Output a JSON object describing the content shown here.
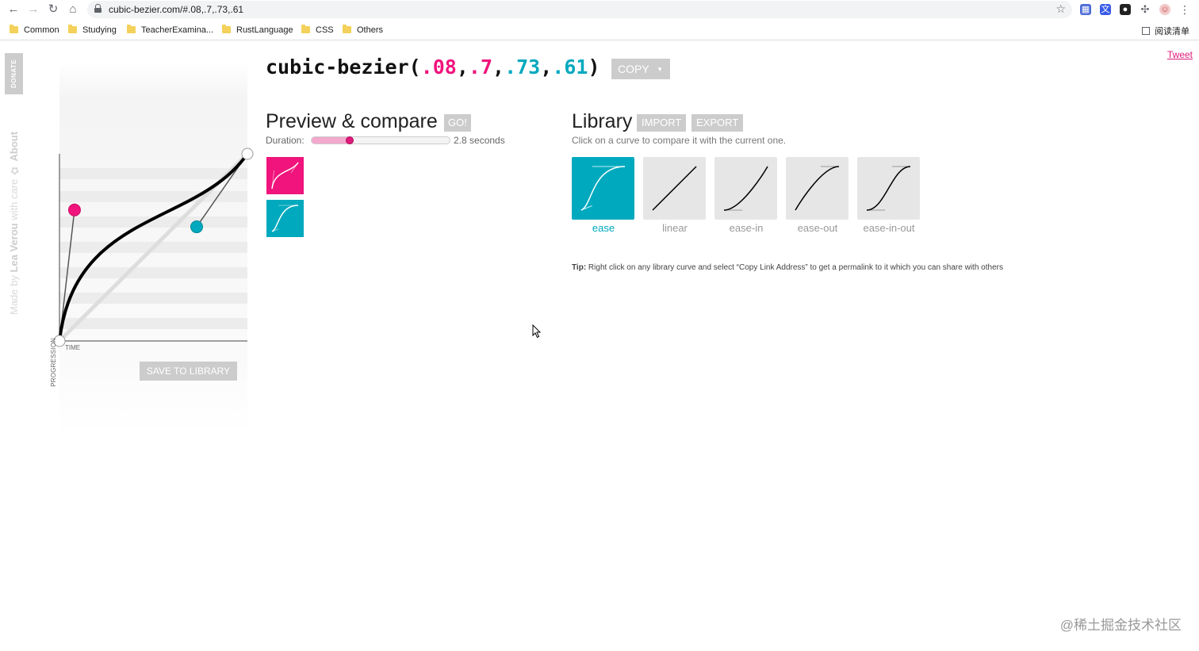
{
  "browser": {
    "url": "cubic-bezier.com/#.08,.7,.73,.61",
    "bookmarks": [
      "Common",
      "Studying",
      "TeacherExamina...",
      "RustLanguage",
      "CSS",
      "Others"
    ],
    "reading_list": "阅读清单"
  },
  "sidebar": {
    "donate": "DONATE",
    "credit_prefix": "Made by ",
    "credit_author": "Lea Verou",
    "credit_suffix": " with care",
    "about": "About"
  },
  "editor": {
    "func_open": "cubic-bezier(",
    "p1x": ".08",
    "p1y": ".7",
    "p2x": ".73",
    "p2y": ".61",
    "func_close": ")",
    "sep": ",",
    "copy_label": "COPY",
    "y_axis_label": "PROGRESSION",
    "x_axis_label": "TIME",
    "save_label": "SAVE TO LIBRARY",
    "control_points": {
      "p1": [
        0.08,
        0.7
      ],
      "p2": [
        0.73,
        0.61
      ]
    }
  },
  "preview": {
    "title": "Preview & compare",
    "go_label": "GO!",
    "duration_label": "Duration:",
    "duration_value": "2.8 seconds",
    "duration_fraction": 0.28
  },
  "library": {
    "title": "Library",
    "import_label": "IMPORT",
    "export_label": "EXPORT",
    "subtitle": "Click on a curve to compare it with the current one.",
    "items": [
      {
        "name": "ease",
        "p": [
          0.25,
          0.1,
          0.25,
          1
        ],
        "active": true
      },
      {
        "name": "linear",
        "p": [
          0,
          0,
          1,
          1
        ],
        "active": false
      },
      {
        "name": "ease-in",
        "p": [
          0.42,
          0,
          1,
          1
        ],
        "active": false
      },
      {
        "name": "ease-out",
        "p": [
          0,
          0,
          0.58,
          1
        ],
        "active": false
      },
      {
        "name": "ease-in-out",
        "p": [
          0.42,
          0,
          0.58,
          1
        ],
        "active": false
      }
    ],
    "tip_bold": "Tip:",
    "tip_text": " Right click on any library curve and select “Copy Link Address” to get a permalink to it which you can share with others"
  },
  "tweet": "Tweet",
  "watermark": "@稀土掘金技术社区",
  "colors": {
    "pink": "#f0147c",
    "cyan": "#00a9be",
    "button_gray": "#cccccc"
  }
}
